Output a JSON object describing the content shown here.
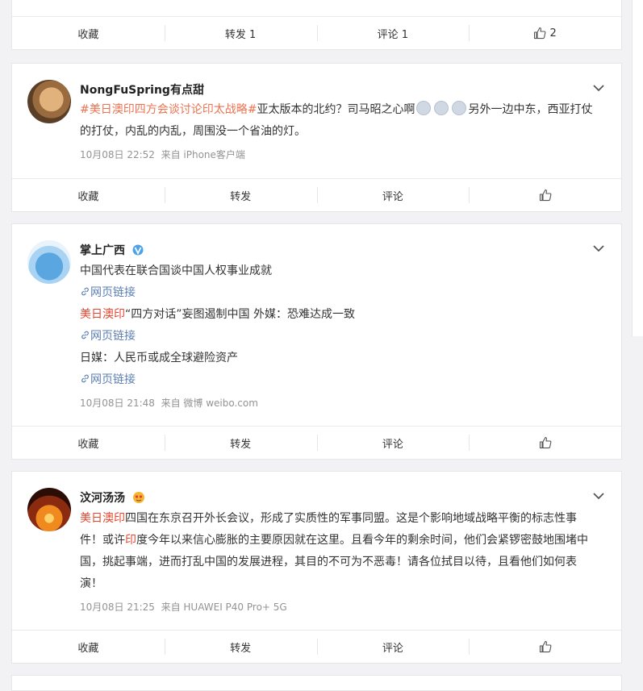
{
  "post0": {
    "actions": {
      "fav": "收藏",
      "repost": "转发 1",
      "comment": "评论 1",
      "like": "2"
    }
  },
  "post1": {
    "user": "NongFuSpring有点甜",
    "hashtag": "#美日澳印四方会谈讨论印太战略#",
    "text_after": "亚太版本的北约？司马昭之心啊",
    "text_tail": "另外一边中东，西亚打仗的打仗，内乱的内乱，周围没一个省油的灯。",
    "time": "10月08日 22:52",
    "source": "来自 iPhone客户端",
    "actions": {
      "fav": "收藏",
      "repost": "转发",
      "comment": "评论",
      "like": ""
    }
  },
  "post2": {
    "user": "掌上广西",
    "line1": "中国代表在联合国谈中国人权事业成就",
    "link": "网页链接",
    "topic2": "美日澳印",
    "line2": "“四方对话”妄图遏制中国 外媒：恐难达成一致",
    "line3": "日媒：人民币或成全球避险资产",
    "time": "10月08日 21:48",
    "source": "来自 微博 weibo.com",
    "actions": {
      "fav": "收藏",
      "repost": "转发",
      "comment": "评论",
      "like": ""
    }
  },
  "post3": {
    "user": "汶河汤汤",
    "topic": "美日澳印",
    "text_a": "四国在东京召开外长会议，形成了实质性的军事同盟。这是个影响地域战略平衡的标志性事件！或许",
    "text_red": "印",
    "text_b": "度今年以来信心膨胀的主要原因就在这里。且看今年的剩余时间，他们会紧锣密鼓地围堵中国，挑起事端，进而打乱中国的发展进程，其目的不可为不恶毒！请各位拭目以待，且看他们如何表演！",
    "time": "10月08日 21:25",
    "source": "来自 HUAWEI P40 Pro+ 5G",
    "actions": {
      "fav": "收藏",
      "repost": "转发",
      "comment": "评论",
      "like": ""
    }
  },
  "colors": {
    "accent": "#eb7350",
    "link": "#5d7fb1",
    "muted": "#939393",
    "bg": "#f2f2f5"
  },
  "icons": {
    "like": "thumbs-up-icon",
    "more": "chevron-down-icon",
    "link": "link-icon",
    "verified": "verified-badge-icon"
  }
}
